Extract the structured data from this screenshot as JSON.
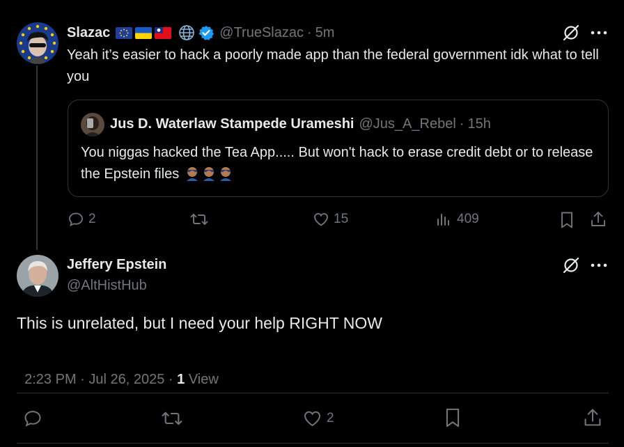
{
  "parent_tweet": {
    "author_name": "Slazac",
    "handle": "@TrueSlazac",
    "separator": "·",
    "time": "5m",
    "text": "Yeah it’s easier to hack a poorly made app than the federal government idk what to tell you",
    "flags": [
      "eu-flag",
      "ukraine-flag",
      "taiwan-flag"
    ],
    "quote": {
      "author_name": "Jus D. Waterlaw Stampede Urameshi",
      "handle": "@Jus_A_Rebel",
      "separator": "·",
      "time": "15h",
      "text": "You niggas hacked the Tea App..... But won't hack to erase credit debt or to release the Epstein files",
      "emoji": [
        "facepalm-emoji",
        "facepalm-emoji",
        "facepalm-emoji"
      ]
    },
    "actions": {
      "replies": "2",
      "reposts": "",
      "likes": "15",
      "views": "409"
    }
  },
  "main_tweet": {
    "author_name": "Jeffery Epstein",
    "handle": "@AltHistHub",
    "text": "This is unrelated, but I need your help RIGHT NOW",
    "timestamp": "2:23 PM · Jul 26, 2025 · ",
    "views_count": "1",
    "views_label": "View",
    "actions": {
      "replies": "",
      "reposts": "",
      "likes": "2"
    }
  },
  "colors": {
    "background": "#000000",
    "text": "#e7e9ea",
    "muted": "#71767b",
    "border": "#2f3336",
    "verified": "#1d9bf0"
  }
}
